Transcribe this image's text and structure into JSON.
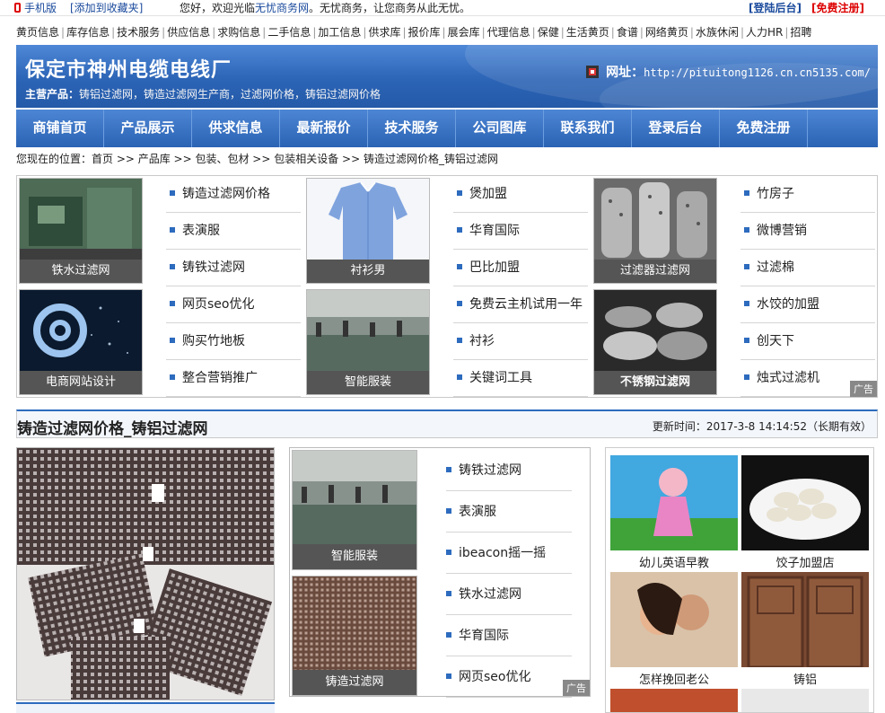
{
  "topbar": {
    "phone": "手机版",
    "favorite": "[添加到收藏夹]",
    "welcome_prefix": "您好，欢迎光临",
    "welcome_site": "无忧商务网",
    "welcome_suffix": "。无忧商务，让您商务从此无忧。",
    "login": "[登陆后台]",
    "register": "[免费注册]"
  },
  "catnav": [
    "黄页信息",
    "库存信息",
    "技术服务",
    "供应信息",
    "求购信息",
    "二手信息",
    "加工信息",
    "供求库",
    "报价库",
    "展会库",
    "代理信息",
    "保健",
    "生活黄页",
    "食谱",
    "网络黄页",
    "水族休闲",
    "人力HR",
    "招聘"
  ],
  "header": {
    "title": "保定市神州电缆电线厂",
    "products_label": "主营产品：",
    "products": "铸铝过滤网，铸造过滤网生产商，过滤网价格，铸铝过滤网价格",
    "url_label": "网址：",
    "url": "http://pituitong1126.cn.cn5135.com/"
  },
  "mainnav": [
    "商铺首页",
    "产品展示",
    "供求信息",
    "最新报价",
    "技术服务",
    "公司图库",
    "联系我们",
    "登录后台",
    "免费注册"
  ],
  "breadcrumb": "您现在的位置：首页 >> 产品库 >> 包装、包材 >> 包装相关设备 >> 铸造过滤网价格_铸铝过滤网",
  "ad_grid": {
    "tiles": [
      "铁水过滤网",
      "衬衫男",
      "过滤器过滤网",
      "电商网站设计",
      "智能服装",
      "不锈钢过滤网"
    ],
    "list1": [
      "铸造过滤网价格",
      "表演服",
      "铸铁过滤网",
      "网页seo优化",
      "购买竹地板",
      "整合营销推广"
    ],
    "list2": [
      "煲加盟",
      "华育国际",
      "巴比加盟",
      "免费云主机试用一年",
      "衬衫",
      "关键词工具"
    ],
    "list3": [
      "竹房子",
      "微博营销",
      "过滤棉",
      "水饺的加盟",
      "创天下",
      "烛式过滤机"
    ],
    "ad_label": "广告"
  },
  "product": {
    "title": "铸造过滤网价格_铸铝过滤网",
    "updated": "更新时间：2017-3-8 14:14:52（长期有效）"
  },
  "mid_ad": {
    "tiles": [
      "智能服装",
      "铸造过滤网"
    ],
    "links": [
      "铸铁过滤网",
      "表演服",
      "ibeacon摇一摇",
      "铁水过滤网",
      "华育国际",
      "网页seo优化"
    ],
    "ad_label": "广告"
  },
  "right_ad": [
    "幼儿英语早教",
    "饺子加盟店",
    "怎样挽回老公",
    "铸铝"
  ],
  "colors": {
    "brand": "#2d6bbe",
    "red": "#dd0000"
  }
}
